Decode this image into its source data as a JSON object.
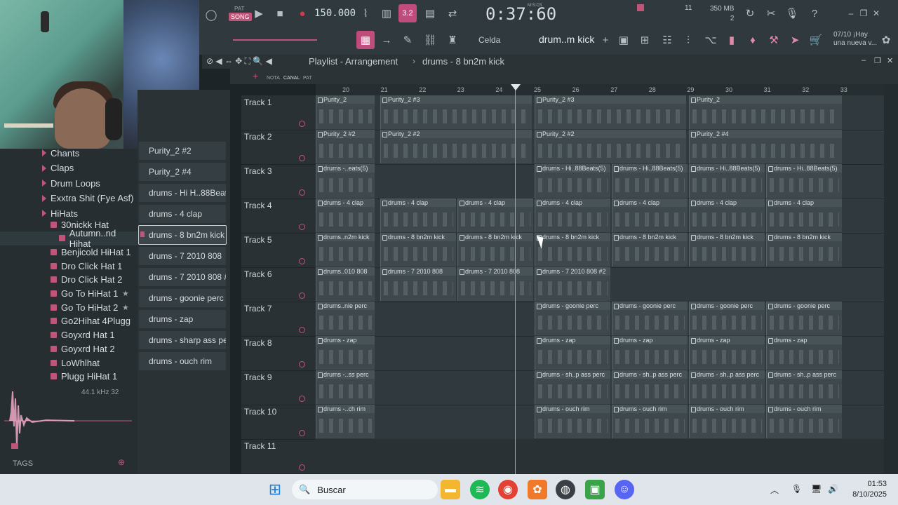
{
  "toolbar": {
    "pat_label": "PAT",
    "song_label": "SONG",
    "tempo": "150.000",
    "time": "0:37:60",
    "time_unit": "M:S:CS",
    "counter": "11",
    "memory": "350 MB",
    "memory_sub": "2",
    "snap_label": "Celda",
    "pattern_name": "drum..m kick",
    "hint_line1": "07/10 ¡Hay",
    "hint_line2": "una nueva v...",
    "step_value": "3.2"
  },
  "playlist": {
    "title": "Playlist - Arrangement",
    "breadcrumb": "drums - 8 bn2m kick",
    "col_labels": [
      "NOTA",
      "CANAL",
      "PAT"
    ],
    "bars": [
      "20",
      "21",
      "22",
      "23",
      "24",
      "25",
      "26",
      "27",
      "28",
      "29",
      "30",
      "31",
      "32",
      "33"
    ],
    "tracks": [
      {
        "name": "Track 1",
        "clips": [
          {
            "label": "Purity_2",
            "start": 0
          },
          {
            "label": "Purity_2 #3",
            "start": 1
          },
          {
            "label": "Purity_2 #3",
            "start": 3
          },
          {
            "label": "Purity_2",
            "start": 5
          }
        ]
      },
      {
        "name": "Track 2",
        "clips": [
          {
            "label": "Purity_2 #2",
            "start": 0
          },
          {
            "label": "Purity_2 #2",
            "start": 1
          },
          {
            "label": "Purity_2 #2",
            "start": 3
          },
          {
            "label": "Purity_2 #4",
            "start": 5
          }
        ]
      },
      {
        "name": "Track 3",
        "clips": [
          {
            "label": "drums -..eats(5)",
            "start": 0
          },
          {
            "label": "drums - Hi..88Beats(5)",
            "start": 3
          },
          {
            "label": "drums - Hi..88Beats(5)",
            "start": 4
          },
          {
            "label": "drums - Hi..88Beats(5)",
            "start": 5
          },
          {
            "label": "drums - Hi..88Beats(5)",
            "start": 6
          }
        ]
      },
      {
        "name": "Track 4",
        "clips": [
          {
            "label": "drums - 4 clap",
            "start": 0
          },
          {
            "label": "drums - 4 clap",
            "start": 1
          },
          {
            "label": "drums - 4 clap",
            "start": 2
          },
          {
            "label": "drums - 4 clap",
            "start": 3
          },
          {
            "label": "drums - 4 clap",
            "start": 4
          },
          {
            "label": "drums - 4 clap",
            "start": 5
          },
          {
            "label": "drums - 4 clap",
            "start": 6
          }
        ]
      },
      {
        "name": "Track 5",
        "clips": [
          {
            "label": "drums..n2m kick",
            "start": 0
          },
          {
            "label": "drums - 8 bn2m kick",
            "start": 1
          },
          {
            "label": "drums - 8 bn2m kick",
            "start": 2
          },
          {
            "label": "drums - 8 bn2m kick",
            "start": 3
          },
          {
            "label": "drums - 8 bn2m kick",
            "start": 4
          },
          {
            "label": "drums - 8 bn2m kick",
            "start": 5
          },
          {
            "label": "drums - 8 bn2m kick",
            "start": 6
          }
        ]
      },
      {
        "name": "Track 6",
        "clips": [
          {
            "label": "drums..010 808",
            "start": 0
          },
          {
            "label": "drums - 7 2010 808",
            "start": 1
          },
          {
            "label": "drums - 7 2010 808",
            "start": 2
          },
          {
            "label": "drums - 7 2010 808 #2",
            "start": 3
          }
        ]
      },
      {
        "name": "Track 7",
        "clips": [
          {
            "label": "drums..nie perc",
            "start": 0
          },
          {
            "label": "drums - goonie perc",
            "start": 3
          },
          {
            "label": "drums - goonie perc",
            "start": 4
          },
          {
            "label": "drums - goonie perc",
            "start": 5
          },
          {
            "label": "drums - goonie perc",
            "start": 6
          }
        ]
      },
      {
        "name": "Track 8",
        "clips": [
          {
            "label": "drums - zap",
            "start": 0
          },
          {
            "label": "drums - zap",
            "start": 3
          },
          {
            "label": "drums - zap",
            "start": 4
          },
          {
            "label": "drums - zap",
            "start": 5
          },
          {
            "label": "drums - zap",
            "start": 6
          }
        ]
      },
      {
        "name": "Track 9",
        "clips": [
          {
            "label": "drums -..ss perc",
            "start": 0
          },
          {
            "label": "drums - sh..p ass perc",
            "start": 3
          },
          {
            "label": "drums - sh..p ass perc",
            "start": 4
          },
          {
            "label": "drums - sh..p ass perc",
            "start": 5
          },
          {
            "label": "drums - sh..p ass perc",
            "start": 6
          }
        ]
      },
      {
        "name": "Track 10",
        "clips": [
          {
            "label": "drums -..ch rim",
            "start": 0
          },
          {
            "label": "drums - ouch rim",
            "start": 3
          },
          {
            "label": "drums - ouch rim",
            "start": 4
          },
          {
            "label": "drums - ouch rim",
            "start": 5
          },
          {
            "label": "drums - ouch rim",
            "start": 6
          }
        ]
      },
      {
        "name": "Track 11",
        "clips": []
      }
    ]
  },
  "picker": {
    "items": [
      "Purity_2 #2",
      "Purity_2 #4",
      "drums - Hi H..88Beats(5)",
      "drums - 4 clap",
      "drums - 8 bn2m kick",
      "drums - 7 2010 808",
      "drums - 7 2010 808 #2",
      "drums - goonie perc",
      "drums - zap",
      "drums - sharp ass perc",
      "drums - ouch rim"
    ],
    "selected_index": 4
  },
  "browser": {
    "folders": [
      "Chants",
      "Claps",
      "Drum Loops",
      "Exxtra Shit (Fye Asf)",
      "HiHats"
    ],
    "files": [
      {
        "label": "30nickk Hat",
        "starred": false
      },
      {
        "label": "Autumn..nd Hihat",
        "starred": false
      },
      {
        "label": "Benjicold HiHat 1",
        "starred": false
      },
      {
        "label": "Dro Click Hat 1",
        "starred": false
      },
      {
        "label": "Dro Click Hat 2",
        "starred": false
      },
      {
        "label": "Go To HiHat 1",
        "starred": true
      },
      {
        "label": "Go To HiHat 2",
        "starred": true
      },
      {
        "label": "Go2Hihat 4Plugg",
        "starred": false
      },
      {
        "label": "Goyxrd Hat 1",
        "starred": false
      },
      {
        "label": "Goyxrd Hat 2",
        "starred": false
      },
      {
        "label": "LoWhlhat",
        "starred": false
      },
      {
        "label": "Plugg HiHat 1",
        "starred": false
      }
    ],
    "sample_rate": "44.1 kHz 32",
    "tags_label": "TAGS"
  },
  "taskbar": {
    "search_placeholder": "Buscar",
    "time": "01:53",
    "date": "8/10/2025"
  },
  "colors": {
    "accent": "#c0557a",
    "clip": "#3f494d",
    "toolbar": "#30393e"
  }
}
